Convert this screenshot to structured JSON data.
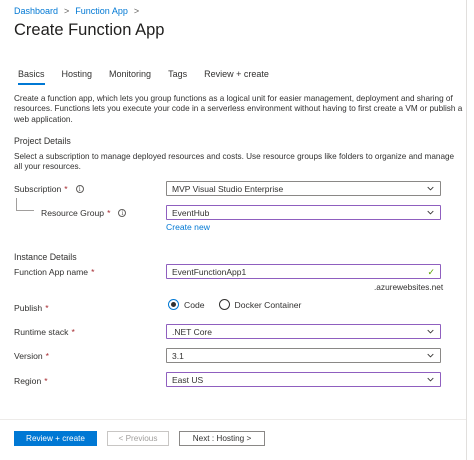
{
  "breadcrumb": {
    "item1": "Dashboard",
    "item2": "Function App",
    "sep": ">"
  },
  "title": "Create Function App",
  "tabs": [
    "Basics",
    "Hosting",
    "Monitoring",
    "Tags",
    "Review + create"
  ],
  "description": "Create a function app, which lets you group functions as a logical unit for easier management, deployment and sharing of resources. Functions lets you execute your code in a serverless environment without having to first create a VM or publish a web application.",
  "project": {
    "heading": "Project Details",
    "description": "Select a subscription to manage deployed resources and costs. Use resource groups like folders to organize and manage all your resources.",
    "subscription_label": "Subscription",
    "subscription_value": "MVP Visual Studio Enterprise",
    "resource_group_label": "Resource Group",
    "resource_group_value": "EventHub",
    "create_new": "Create new"
  },
  "instance": {
    "heading": "Instance Details",
    "name_label": "Function App name",
    "name_value": "EventFunctionApp1",
    "name_suffix": ".azurewebsites.net",
    "publish_label": "Publish",
    "publish_options": [
      "Code",
      "Docker Container"
    ],
    "publish_selected": "Code",
    "runtime_label": "Runtime stack",
    "runtime_value": ".NET Core",
    "version_label": "Version",
    "version_value": "3.1",
    "region_label": "Region",
    "region_value": "East US"
  },
  "required_mark": "*",
  "info_glyph": "i",
  "footer": {
    "review_create": "Review + create",
    "previous": "< Previous",
    "next": "Next : Hosting >"
  },
  "colors": {
    "accent": "#0078d4",
    "focus_border": "#8f5fbf",
    "required": "#a4262c",
    "valid": "#57a300"
  }
}
